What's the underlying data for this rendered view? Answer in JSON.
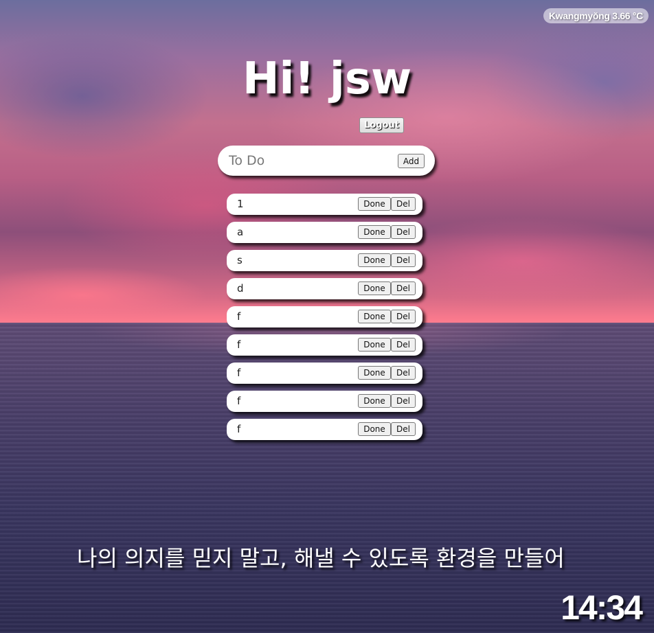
{
  "weather": {
    "text": "Kwangmyŏng 3.66 °C"
  },
  "greeting": {
    "title": "Hi! jsw"
  },
  "logout": {
    "label": "Logout"
  },
  "todo_form": {
    "placeholder": "To Do",
    "add_label": "Add"
  },
  "todos": [
    {
      "text": "1",
      "done_label": "Done",
      "del_label": "Del"
    },
    {
      "text": "a",
      "done_label": "Done",
      "del_label": "Del"
    },
    {
      "text": "s",
      "done_label": "Done",
      "del_label": "Del"
    },
    {
      "text": "d",
      "done_label": "Done",
      "del_label": "Del"
    },
    {
      "text": "f",
      "done_label": "Done",
      "del_label": "Del"
    },
    {
      "text": "f",
      "done_label": "Done",
      "del_label": "Del"
    },
    {
      "text": "f",
      "done_label": "Done",
      "del_label": "Del"
    },
    {
      "text": "f",
      "done_label": "Done",
      "del_label": "Del"
    },
    {
      "text": "f",
      "done_label": "Done",
      "del_label": "Del"
    }
  ],
  "quote": {
    "text": "나의 의지를 믿지 말고, 해낼 수 있도록 환경을 만들어"
  },
  "clock": {
    "time": "14:34"
  },
  "colors": {
    "text": "#ffffff",
    "item_bg": "#ffffff",
    "button_bg": "#f0f0f0"
  }
}
